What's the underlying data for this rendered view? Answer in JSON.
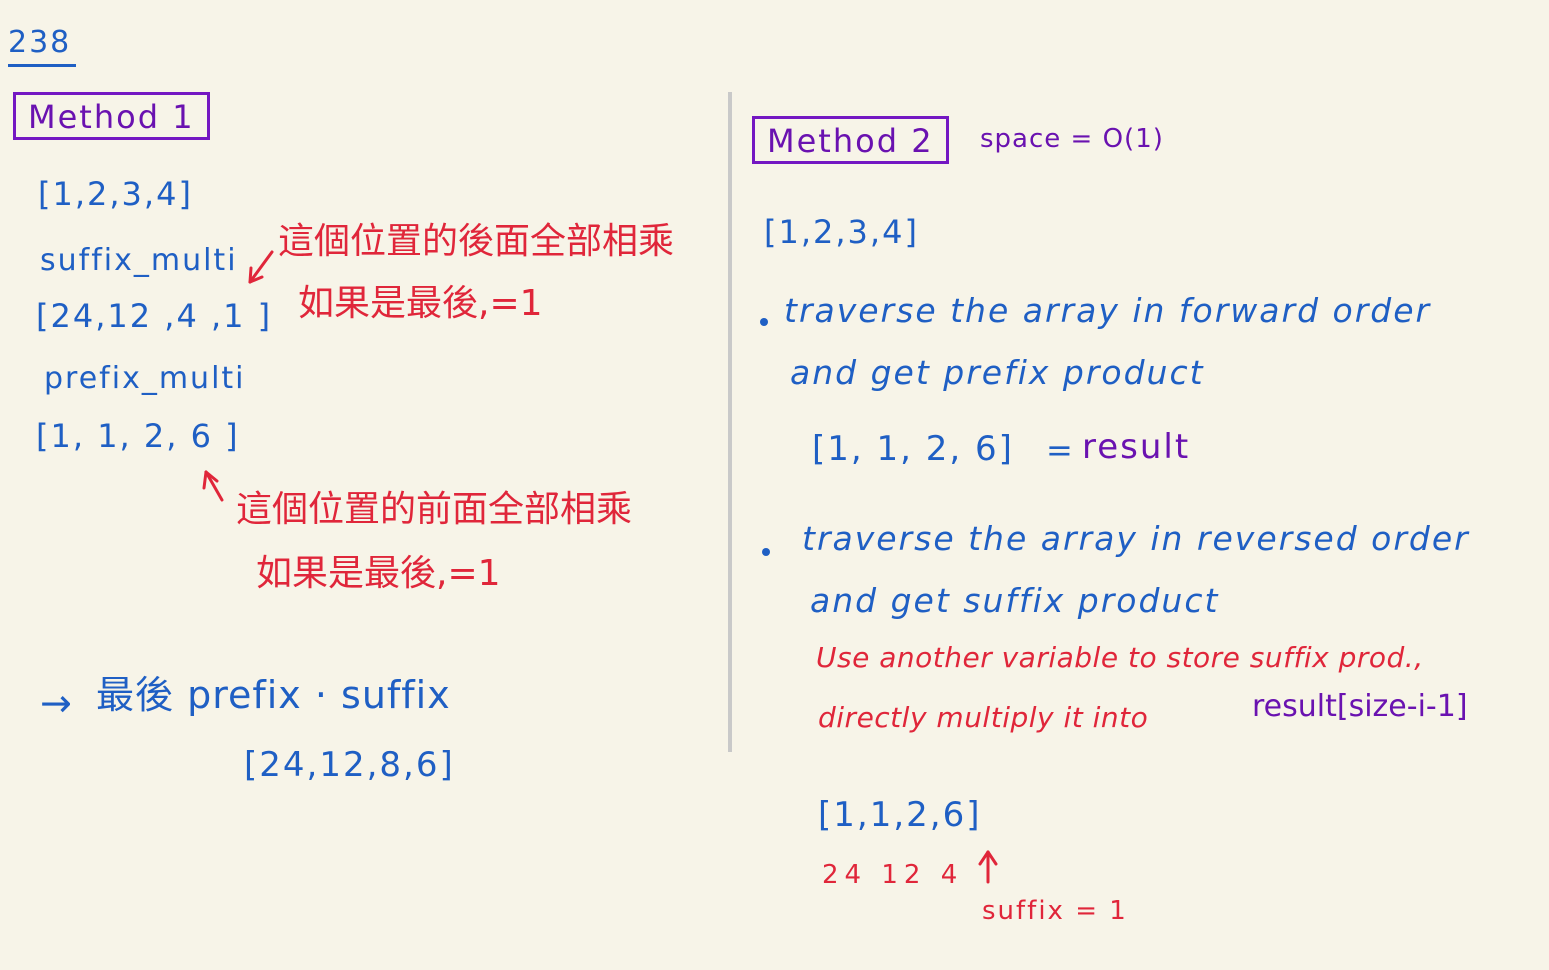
{
  "problem_number": "238",
  "left": {
    "method_title": "Method 1",
    "input_array": "[1,2,3,4]",
    "suffix_label": "suffix_multi",
    "suffix_note_line1": "這個位置的後面全部相乘",
    "suffix_note_line2": "如果是最後,=1",
    "suffix_array": "[24,12 ,4 ,1 ]",
    "prefix_label": "prefix_multi",
    "prefix_array": "[1, 1, 2, 6 ]",
    "prefix_note_line1": "這個位置的前面全部相乘",
    "prefix_note_line2": "如果是最後,=1",
    "final_arrow": "→",
    "final_text": "最後 prefix · suffix",
    "final_array": "[24,12,8,6]"
  },
  "right": {
    "method_title": "Method 2",
    "space_note": "space = O(1)",
    "input_array": "[1,2,3,4]",
    "step1_line1": "traverse the array in forward order",
    "step1_line2": "and get prefix product",
    "step1_result_array": "[1, 1, 2, 6]",
    "step1_result_eq": "=",
    "step1_result_label": "result",
    "step2_line1": "traverse the array in reversed order",
    "step2_line2": "and get suffix product",
    "step2_note_line1": "Use another variable to store suffix prod.,",
    "step2_note_line2_red": "directly multiply it into",
    "step2_note_line2_purple": "result[size-i-1]",
    "example_array": "[1,1,2,6]",
    "example_suffixes": "24 12 4",
    "example_suffix_init": "suffix = 1"
  },
  "colors": {
    "background": "#f7f4e8",
    "blue_ink": "#1f5fc4",
    "red_ink": "#e0263a",
    "purple_ink": "#6a12b0"
  }
}
